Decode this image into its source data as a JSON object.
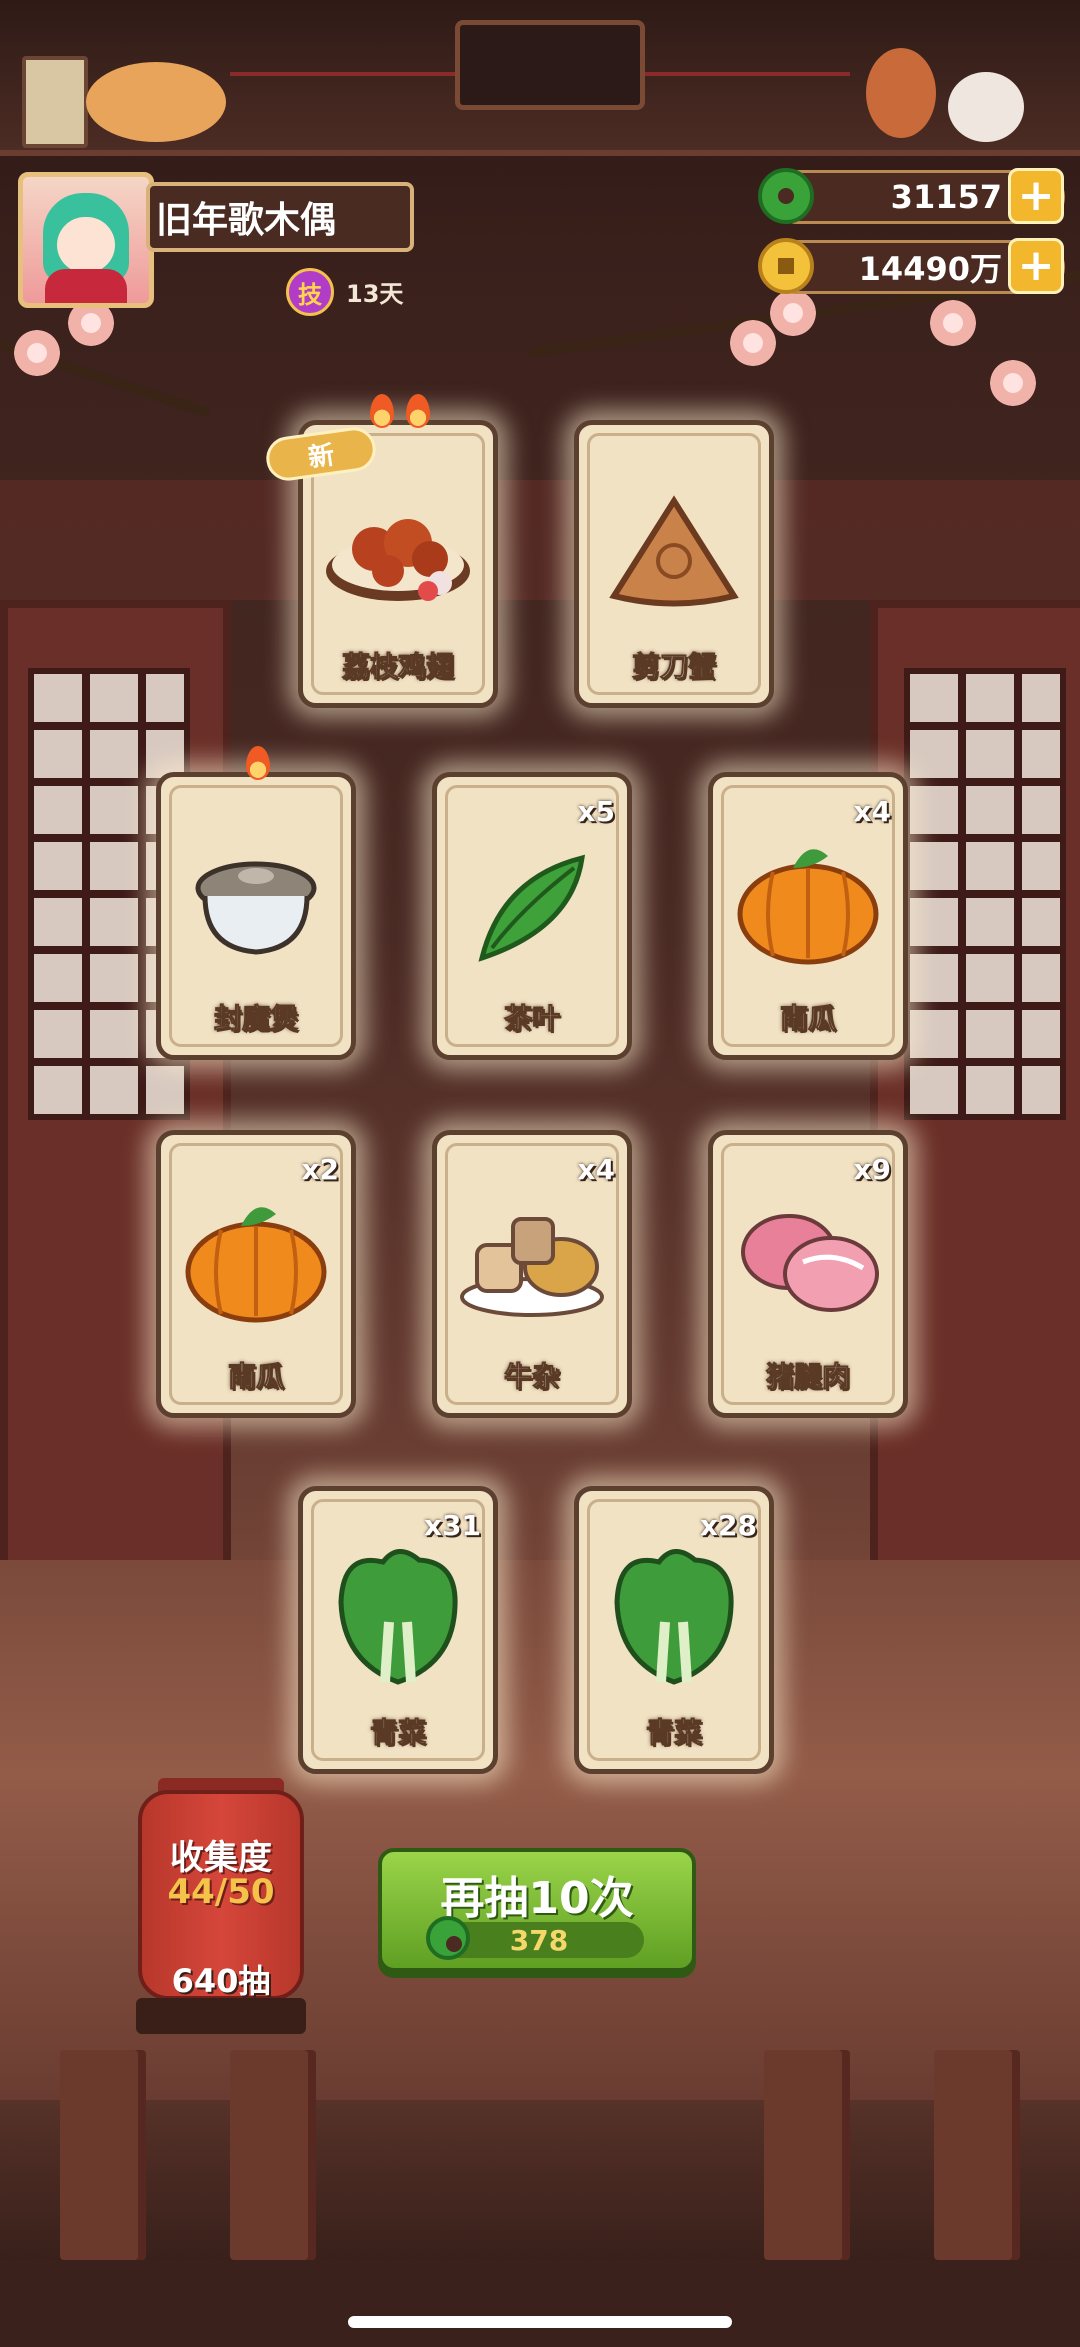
{
  "player": {
    "name": "旧年歌木偶",
    "skill_badge": "技",
    "skill_time": "13天"
  },
  "currency": {
    "jade": "31157",
    "coins": "14490万",
    "plus": "+"
  },
  "cards": [
    {
      "name": "荔枝鸡翅",
      "count": "",
      "badge": "新",
      "food_icon": "lychee-chicken-wings-icon"
    },
    {
      "name": "剪刀蟹",
      "count": "",
      "badge": "",
      "food_icon": "scissor-crab-icon"
    },
    {
      "name": "封魔煲",
      "count": "",
      "badge": "",
      "food_icon": "sealed-pot-icon"
    },
    {
      "name": "茶叶",
      "count": "x5",
      "badge": "",
      "food_icon": "tea-leaf-icon"
    },
    {
      "name": "南瓜",
      "count": "x4",
      "badge": "",
      "food_icon": "pumpkin-icon"
    },
    {
      "name": "南瓜",
      "count": "x2",
      "badge": "",
      "food_icon": "pumpkin-icon"
    },
    {
      "name": "牛杂",
      "count": "x4",
      "badge": "",
      "food_icon": "beef-offal-icon"
    },
    {
      "name": "猪腿肉",
      "count": "x9",
      "badge": "",
      "food_icon": "pork-leg-icon"
    },
    {
      "name": "青菜",
      "count": "x31",
      "badge": "",
      "food_icon": "bok-choy-icon"
    },
    {
      "name": "青菜",
      "count": "x28",
      "badge": "",
      "food_icon": "bok-choy-icon"
    }
  ],
  "collection": {
    "label": "收集度",
    "progress": "44/50",
    "draws": "640抽"
  },
  "draw_button": {
    "label": "再抽10次",
    "cost": "378"
  },
  "colors": {
    "button_green": "#7cbf36",
    "lantern_red": "#c93f33",
    "card_bg": "#f1e2c4",
    "progress_text": "#f5c24a"
  }
}
